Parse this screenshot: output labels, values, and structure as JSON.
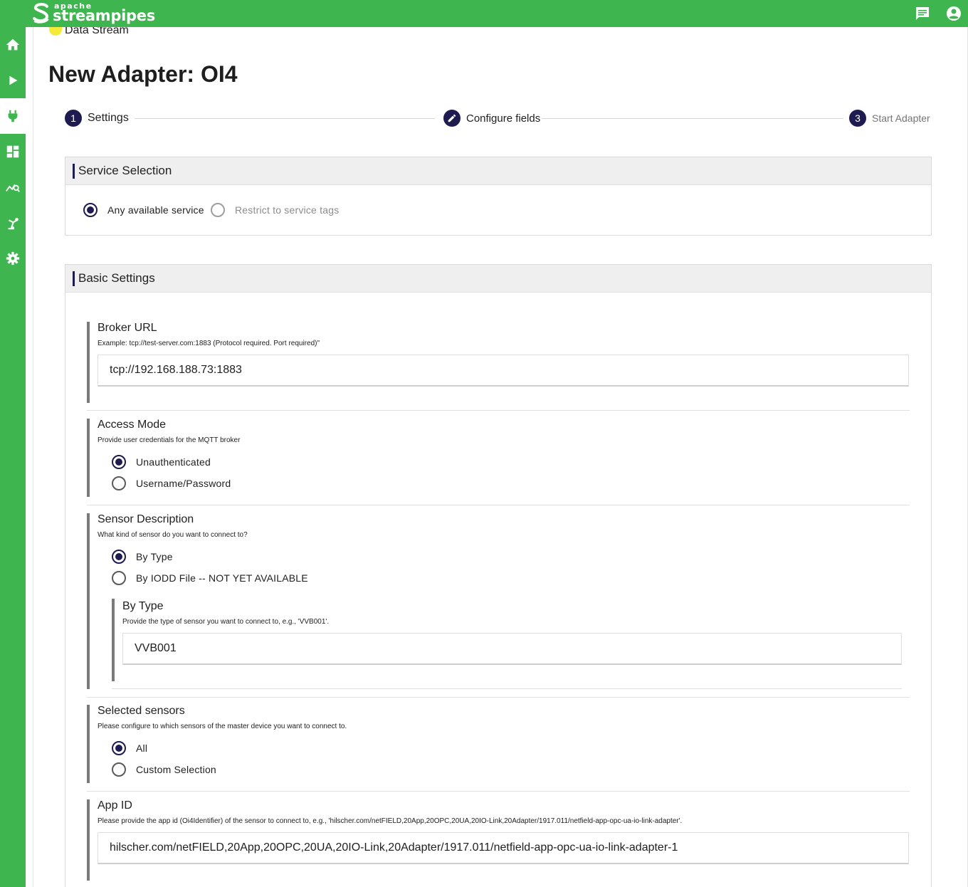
{
  "header": {
    "logo_small": "apache",
    "logo_name": "streampipes",
    "icons": [
      "chat-icon",
      "account-icon"
    ]
  },
  "sidebar": {
    "items": [
      "home-icon",
      "pipeline-icon",
      "connect-icon",
      "dashboard-icon",
      "data-explorer-icon",
      "assets-icon",
      "settings-icon"
    ],
    "active_index": 2
  },
  "breadcrumb_stream": "Data Stream",
  "title": "New Adapter: OI4",
  "stepper": {
    "steps": [
      {
        "number": "1",
        "label": "Settings"
      },
      {
        "number": "",
        "label": "Configure fields"
      },
      {
        "number": "3",
        "label": "Start Adapter"
      }
    ]
  },
  "service_selection": {
    "title": "Service Selection",
    "options": [
      "Any available service",
      "Restrict to service tags"
    ],
    "selected": 0
  },
  "basic_settings": {
    "title": "Basic Settings",
    "broker_url": {
      "label": "Broker URL",
      "hint": "Example: tcp://test-server.com:1883 (Protocol required. Port required)\"",
      "value": "tcp://192.168.188.73:1883"
    },
    "access_mode": {
      "label": "Access Mode",
      "hint": "Provide user credentials for the MQTT broker",
      "options": [
        "Unauthenticated",
        "Username/Password"
      ],
      "selected": 0
    },
    "sensor_description": {
      "label": "Sensor Description",
      "hint": "What kind of sensor do you want to connect to?",
      "options": [
        "By Type",
        "By IODD File -- NOT YET AVAILABLE"
      ],
      "selected": 0,
      "by_type": {
        "label": "By Type",
        "hint": "Provide the type of sensor you want to connect to, e.g., 'VVB001'.",
        "value": "VVB001"
      }
    },
    "selected_sensors": {
      "label": "Selected sensors",
      "hint": "Please configure to which sensors of the master device you want to connect to.",
      "options": [
        "All",
        "Custom Selection"
      ],
      "selected": 0
    },
    "app_id": {
      "label": "App ID",
      "hint": "Please provide the app id (Oi4Identifier) of the sensor to connect to, e.g., 'hilscher.com/netFIELD,20App,20OPC,20UA,20IO-Link,20Adapter/1917.011/netfield-app-opc-ua-io-link-adapter'.",
      "value": "hilscher.com/netFIELD,20App,20OPC,20UA,20IO-Link,20Adapter/1917.011/netfield-app-opc-ua-io-link-adapter-1"
    }
  },
  "colors": {
    "brand_green": "#3fb550",
    "accent_navy": "#1d1b4f",
    "stream_yellow": "#f5e93a"
  }
}
